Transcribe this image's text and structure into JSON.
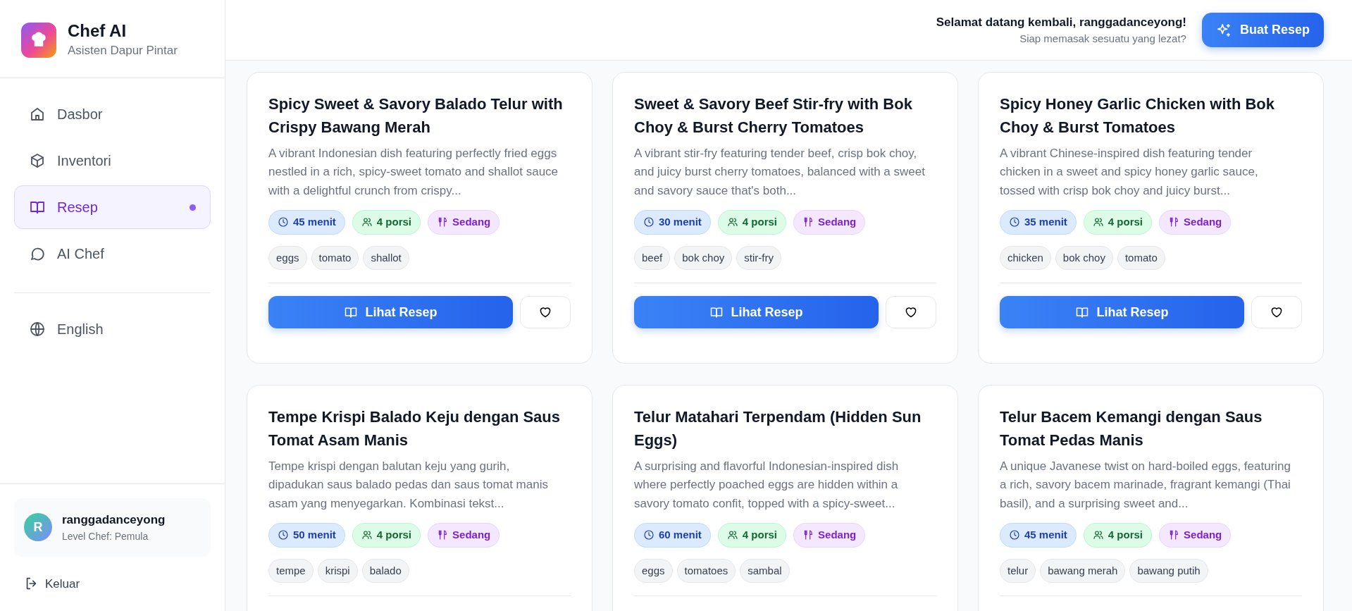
{
  "brand": {
    "title": "Chef AI",
    "subtitle": "Asisten Dapur Pintar"
  },
  "nav": [
    {
      "label": "Dasbor",
      "selected": false
    },
    {
      "label": "Inventori",
      "selected": false
    },
    {
      "label": "Resep",
      "selected": true
    },
    {
      "label": "AI Chef",
      "selected": false
    }
  ],
  "language": {
    "label": "English",
    "selected": false
  },
  "user": {
    "initial": "R",
    "name": "ranggadanceyong",
    "level": "Level Chef: Pemula"
  },
  "logout": {
    "label": "Keluar"
  },
  "header": {
    "greeting": "Selamat datang kembali, ranggadanceyong!",
    "subtitle": "Siap memasak sesuatu yang lezat?",
    "button": "Buat Resep"
  },
  "recipes": [
    {
      "title": "Spicy Sweet & Savory Balado Telur with Crispy Bawang Merah",
      "description": "A vibrant Indonesian dish featuring perfectly fried eggs nestled in a rich, spicy-sweet tomato and shallot sauce with a delightful crunch from crispy...",
      "time": "45 menit",
      "servings": "4 porsi",
      "difficulty": "Sedang",
      "tags": [
        "eggs",
        "tomato",
        "shallot"
      ],
      "view_button": "Lihat Resep",
      "favorite": false
    },
    {
      "title": "Sweet & Savory Beef Stir-fry with Bok Choy & Burst Cherry Tomatoes",
      "description": "A vibrant stir-fry featuring tender beef, crisp bok choy, and juicy burst cherry tomatoes, balanced with a sweet and savory sauce that's both...",
      "time": "30 menit",
      "servings": "4 porsi",
      "difficulty": "Sedang",
      "tags": [
        "beef",
        "bok choy",
        "stir-fry"
      ],
      "view_button": "Lihat Resep",
      "favorite": false
    },
    {
      "title": "Spicy Honey Garlic Chicken with Bok Choy & Burst Tomatoes",
      "description": "A vibrant Chinese-inspired dish featuring tender chicken in a sweet and spicy honey garlic sauce, tossed with crisp bok choy and juicy burst...",
      "time": "35 menit",
      "servings": "4 porsi",
      "difficulty": "Sedang",
      "tags": [
        "chicken",
        "bok choy",
        "tomato"
      ],
      "view_button": "Lihat Resep",
      "favorite": false
    },
    {
      "title": "Tempe Krispi Balado Keju dengan Saus Tomat Asam Manis",
      "description": "Tempe krispi dengan balutan keju yang gurih, dipadukan saus balado pedas dan saus tomat manis asam yang menyegarkan. Kombinasi tekst...",
      "time": "50 menit",
      "servings": "4 porsi",
      "difficulty": "Sedang",
      "tags": [
        "tempe",
        "krispi",
        "balado"
      ]
    },
    {
      "title": "Telur Matahari Terpendam (Hidden Sun Eggs)",
      "description": "A surprising and flavorful Indonesian-inspired dish where perfectly poached eggs are hidden within a savory tomato confit, topped with a spicy-sweet...",
      "time": "60 menit",
      "servings": "4 porsi",
      "difficulty": "Sedang",
      "tags": [
        "eggs",
        "tomatoes",
        "sambal"
      ]
    },
    {
      "title": "Telur Bacem Kemangi dengan Saus Tomat Pedas Manis",
      "description": "A unique Javanese twist on hard-boiled eggs, featuring a rich, savory bacem marinade, fragrant kemangi (Thai basil), and a surprising sweet and...",
      "time": "45 menit",
      "servings": "4 porsi",
      "difficulty": "Sedang",
      "tags": [
        "telur",
        "bawang merah",
        "bawang putih"
      ]
    }
  ]
}
